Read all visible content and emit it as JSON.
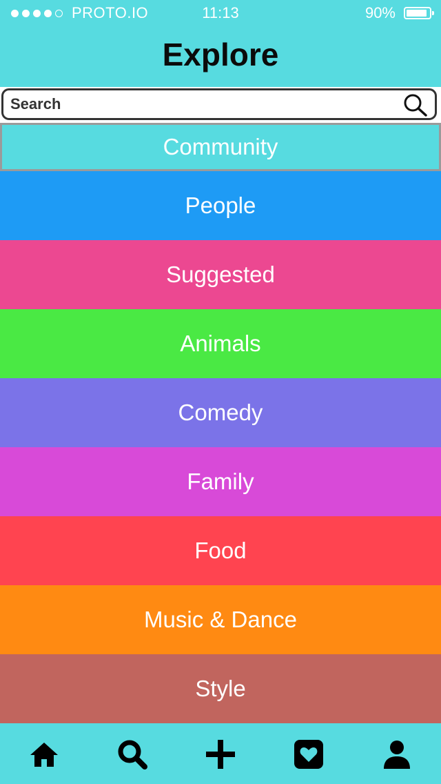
{
  "status_bar": {
    "carrier": "PROTO.IO",
    "time": "11:13",
    "battery_percent": "90%",
    "battery_level": 0.9,
    "signal_dots_filled": 4,
    "signal_dots_total": 5
  },
  "header": {
    "title": "Explore"
  },
  "search": {
    "placeholder": "Search",
    "icon": "search-icon"
  },
  "categories": [
    {
      "label": "Community",
      "color": "#57DBE0",
      "selected": true
    },
    {
      "label": "People",
      "color": "#1E9BF5"
    },
    {
      "label": "Suggested",
      "color": "#EC4891"
    },
    {
      "label": "Animals",
      "color": "#4AE944"
    },
    {
      "label": "Comedy",
      "color": "#7B73E8"
    },
    {
      "label": "Family",
      "color": "#D84AD8"
    },
    {
      "label": "Food",
      "color": "#FF4450"
    },
    {
      "label": "Music & Dance",
      "color": "#FF8A12"
    },
    {
      "label": "Style",
      "color": "#C1655E"
    }
  ],
  "tab_bar": {
    "items": [
      {
        "icon": "home-icon"
      },
      {
        "icon": "search-icon"
      },
      {
        "icon": "plus-icon"
      },
      {
        "icon": "heart-icon"
      },
      {
        "icon": "person-icon"
      }
    ]
  },
  "colors": {
    "accent": "#57DBE0",
    "title_text": "#0b0b0b"
  }
}
